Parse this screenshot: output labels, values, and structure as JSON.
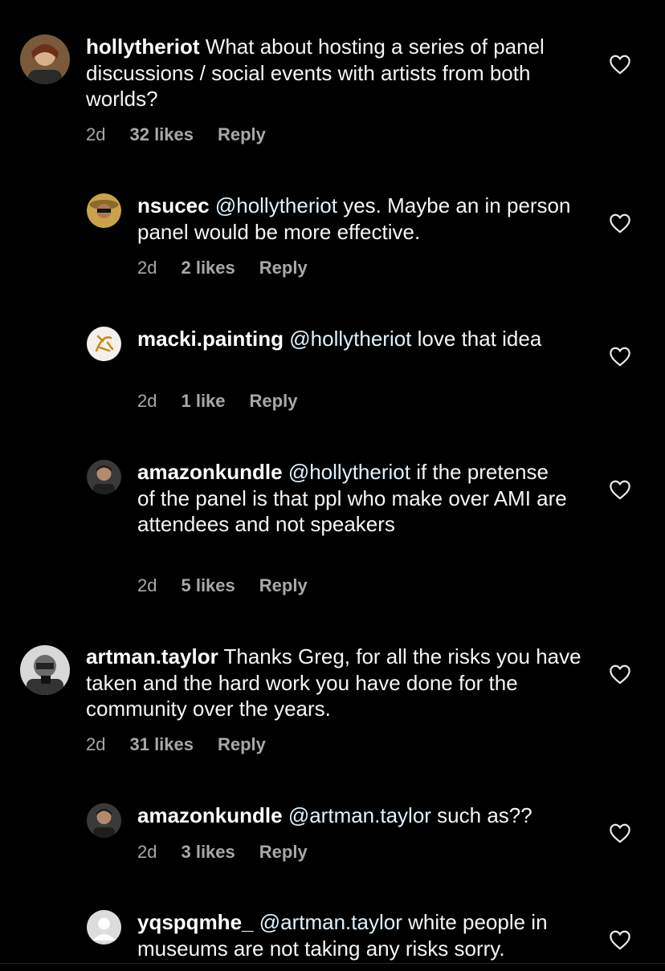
{
  "comments": [
    {
      "username": "hollytheriot",
      "mention": "",
      "body": " What about hosting a series of panel discussions / social events with artists from both worlds?",
      "time": "2d",
      "likes": "32 likes",
      "reply": "Reply"
    },
    {
      "username": "nsucec",
      "mention": "@hollytheriot",
      "body": " yes. Maybe an in person panel would be more effective.",
      "time": "2d",
      "likes": "2 likes",
      "reply": "Reply"
    },
    {
      "username": "macki.painting",
      "mention": "@hollytheriot",
      "body": " love that idea",
      "time": "2d",
      "likes": "1 like",
      "reply": "Reply"
    },
    {
      "username": "amazonkundle",
      "mention": "@hollytheriot",
      "body": " if the pretense of the panel is that ppl who make over AMI are attendees and not speakers",
      "time": "2d",
      "likes": "5 likes",
      "reply": "Reply"
    },
    {
      "username": "artman.taylor",
      "mention": "",
      "body": " Thanks Greg, for all the risks you have taken and the hard work you have done for the community over the years.",
      "time": "2d",
      "likes": "31 likes",
      "reply": "Reply"
    },
    {
      "username": "amazonkundle",
      "mention": "@artman.taylor",
      "body": " such as??",
      "time": "2d",
      "likes": "3 likes",
      "reply": "Reply"
    },
    {
      "username": "yqspqmhe_",
      "mention": "@artman.taylor",
      "body": " white people in museums are not taking any risks sorry.",
      "time": "",
      "likes": "",
      "reply": ""
    }
  ],
  "icons": {
    "like": "heart-outline-icon"
  }
}
